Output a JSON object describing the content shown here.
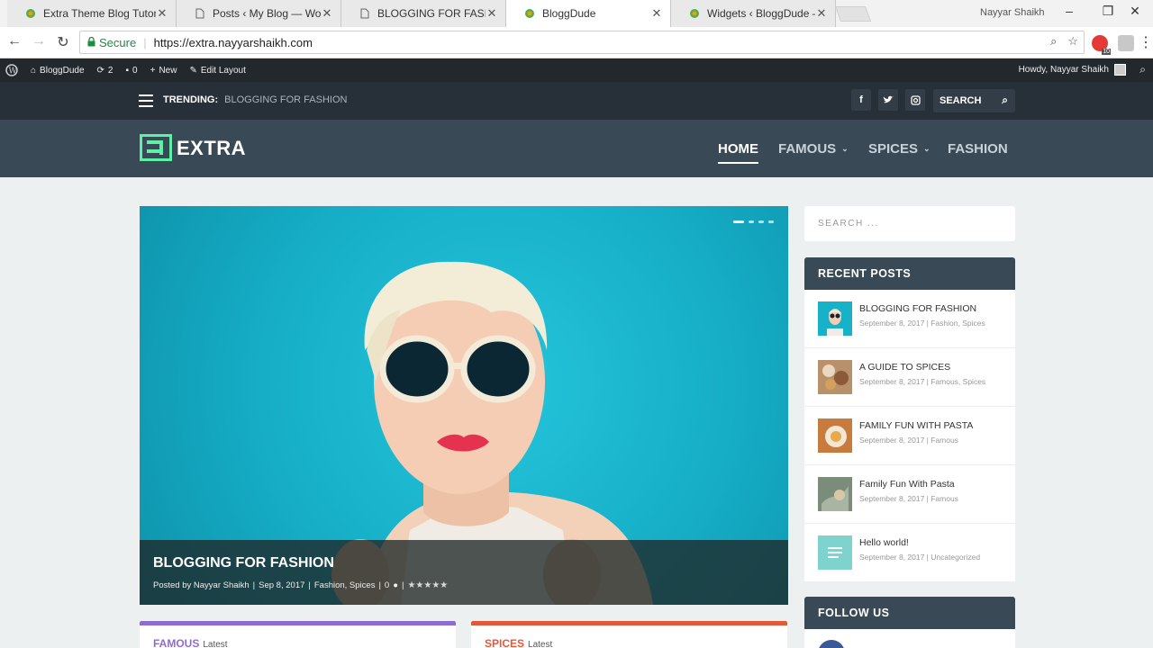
{
  "browser": {
    "tabs": [
      {
        "title": "Extra Theme Blog Tutoria",
        "icon": "bloggdude-favicon",
        "active": false
      },
      {
        "title": "Posts ‹ My Blog — Word",
        "icon": "page-icon",
        "active": false
      },
      {
        "title": "BLOGGING FOR FASHIO",
        "icon": "page-icon",
        "active": false
      },
      {
        "title": "BloggDude",
        "icon": "bloggdude-favicon",
        "active": true
      },
      {
        "title": "Widgets ‹ BloggDude —",
        "icon": "bloggdude-favicon",
        "active": false
      }
    ],
    "profile_name": "Nayyar Shaikh",
    "secure_label": "Secure",
    "url": "https://extra.nayyarshaikh.com",
    "extension_badge": "10"
  },
  "admin_bar": {
    "site_name": "BloggDude",
    "updates_count": "2",
    "comments_count": "0",
    "new_label": "New",
    "edit_label": "Edit Layout",
    "howdy": "Howdy, Nayyar Shaikh"
  },
  "topbar": {
    "trending_label": "TRENDING:",
    "trending_link": "BLOGGING FOR FASHION",
    "search_label": "SEARCH",
    "social": [
      "f",
      "t",
      "ig"
    ]
  },
  "header": {
    "logo_text": "EXTRA",
    "nav": [
      {
        "label": "HOME",
        "active": true,
        "has_caret": false
      },
      {
        "label": "FAMOUS",
        "active": false,
        "has_caret": true
      },
      {
        "label": "SPICES",
        "active": false,
        "has_caret": true
      },
      {
        "label": "FASHION",
        "active": false,
        "has_caret": false
      }
    ]
  },
  "hero": {
    "title": "BLOGGING FOR FASHION",
    "posted_by": "Posted by Nayyar Shaikh",
    "date": "Sep 8, 2017",
    "categories": "Fashion, Spices",
    "comments": "0",
    "rating_stars": 5,
    "slides": 4,
    "active_slide": 0,
    "background_color": "#16aec7"
  },
  "categories": [
    {
      "title": "FAMOUS",
      "latest": "Latest",
      "color": "#8e6ccf"
    },
    {
      "title": "SPICES",
      "latest": "Latest",
      "color": "#e05a3a"
    }
  ],
  "sidebar": {
    "search_placeholder": "SEARCH ...",
    "recent_posts_title": "RECENT POSTS",
    "posts": [
      {
        "title": "BLOGGING FOR FASHION",
        "meta": "September 8, 2017 | Fashion, Spices",
        "thumb_color": "#17b2c8"
      },
      {
        "title": "A GUIDE TO SPICES",
        "meta": "September 8, 2017 | Famous, Spices",
        "thumb_color": "#b8916a"
      },
      {
        "title": "FAMILY FUN WITH PASTA",
        "meta": "September 8, 2017 | Famous",
        "thumb_color": "#c77b3d"
      },
      {
        "title": "Family Fun With Pasta",
        "meta": "September 8, 2017 | Famous",
        "thumb_color": "#7b8c7a"
      },
      {
        "title": "Hello world!",
        "meta": "September 8, 2017 | Uncategorized",
        "thumb_color": "#7fd3cf"
      }
    ],
    "follow_title": "FOLLOW US"
  }
}
